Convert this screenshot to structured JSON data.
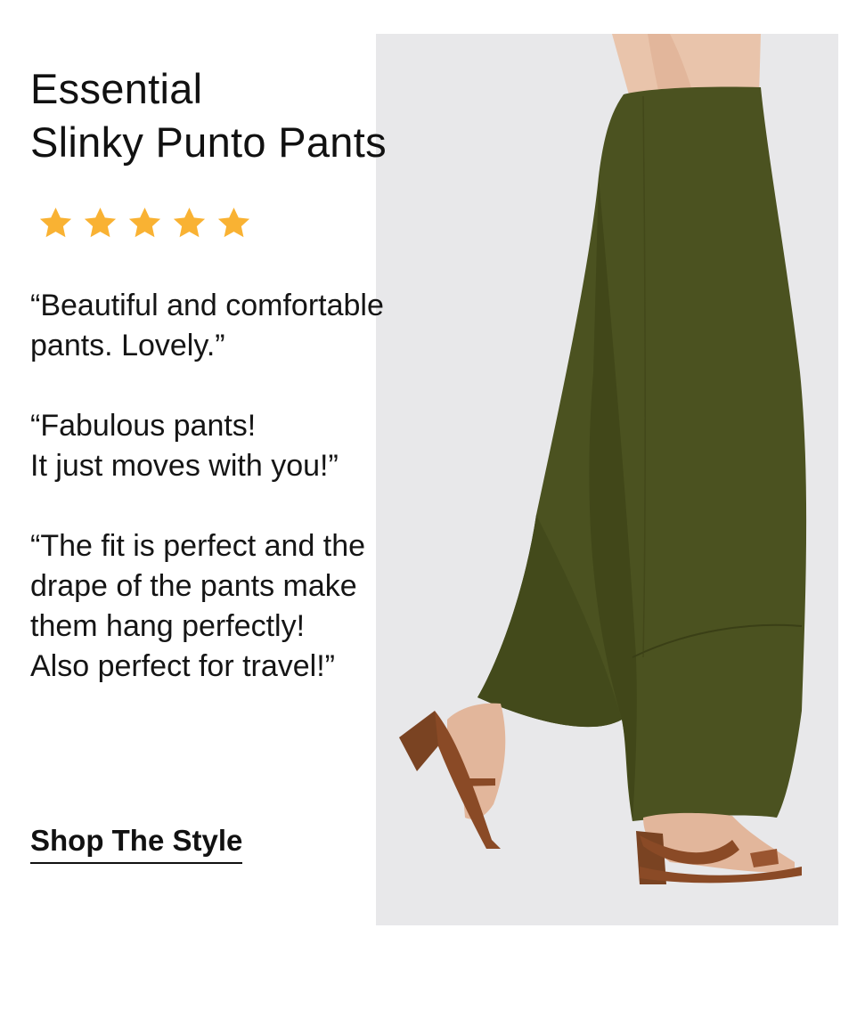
{
  "product": {
    "title_line1": "Essential",
    "title_line2": "Slinky Punto Pants",
    "rating": 5,
    "rating_max": 5,
    "star_color": "#f9b233"
  },
  "reviews": [
    {
      "lines": [
        "“Beautiful and comfortable",
        "pants. Lovely.”"
      ]
    },
    {
      "lines": [
        "“Fabulous pants!",
        "It just moves with you!”"
      ]
    },
    {
      "lines": [
        "“The fit is perfect and the",
        "drape of the pants make",
        "them hang perfectly!",
        "Also perfect for travel!”"
      ]
    }
  ],
  "cta": {
    "label": "Shop The Style"
  },
  "photo": {
    "icon": "model-wearing-wide-leg-pants-image",
    "pants_color": "#4b5220",
    "sandal_color": "#8a4a26",
    "background": "#e8e8ea"
  }
}
